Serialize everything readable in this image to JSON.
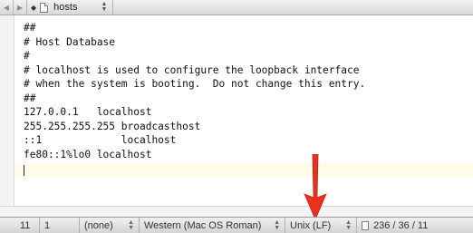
{
  "navbar": {
    "back_icon": "back-arrow-icon",
    "forward_icon": "forward-arrow-icon",
    "document_name": "hosts"
  },
  "editor": {
    "lines": [
      "##",
      "# Host Database",
      "#",
      "# localhost is used to configure the loopback interface",
      "# when the system is booting.  Do not change this entry.",
      "##",
      "127.0.0.1   localhost",
      "255.255.255.255 broadcasthost",
      "::1             localhost",
      "fe80::1%lo0 localhost"
    ]
  },
  "statusbar": {
    "line": "11",
    "column": "1",
    "syntax": "(none)",
    "encoding": "Western (Mac OS Roman)",
    "line_endings": "Unix (LF)",
    "stats": "236 / 36 / 11"
  },
  "colors": {
    "annotation_arrow": "#e8321f",
    "current_line_highlight": "#fdfce8"
  }
}
